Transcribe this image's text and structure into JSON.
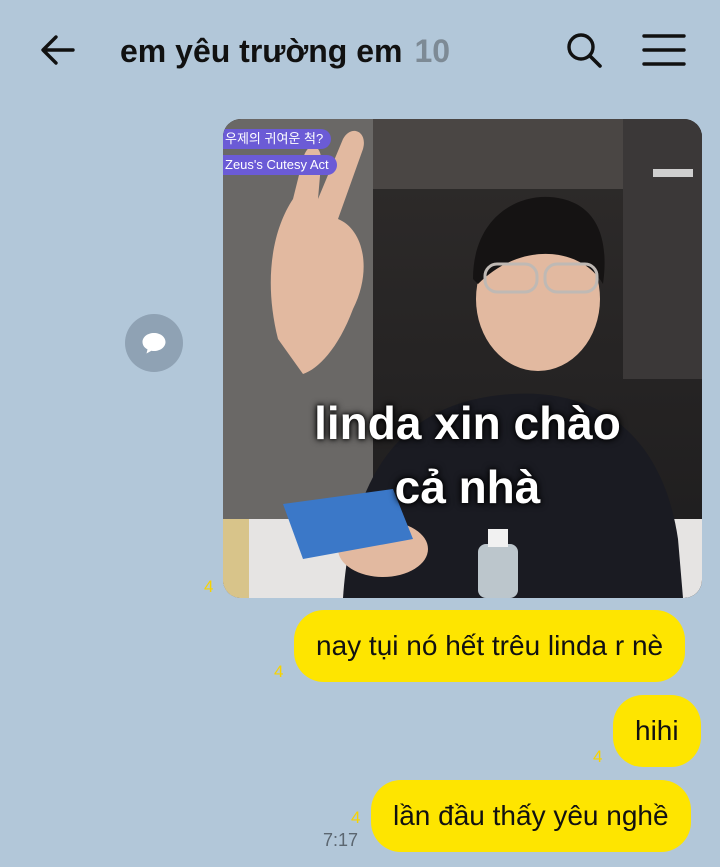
{
  "header": {
    "title": "em yêu trường em",
    "member_count": "10",
    "back_icon": "arrow-left-icon",
    "search_icon": "search-icon",
    "menu_icon": "hamburger-menu-icon"
  },
  "messages": [
    {
      "type": "image",
      "unread": "4",
      "overlay_badge_kr": "우제의 귀여운 척?",
      "overlay_badge_en": "Zeus's Cutesy Act",
      "caption_line1": "linda xin chào",
      "caption_line2": "cả nhà"
    },
    {
      "type": "text",
      "unread": "4",
      "text": "nay tụi nó hết trêu linda r nè"
    },
    {
      "type": "text",
      "unread": "4",
      "text": "hihi"
    },
    {
      "type": "text",
      "unread": "4",
      "text": "lần đầu thấy yêu nghề",
      "time": "7:17"
    }
  ],
  "colors": {
    "background": "#b2c7d9",
    "bubble": "#fee500",
    "unread": "#f7d300",
    "share_button": "#8fa2b4"
  }
}
